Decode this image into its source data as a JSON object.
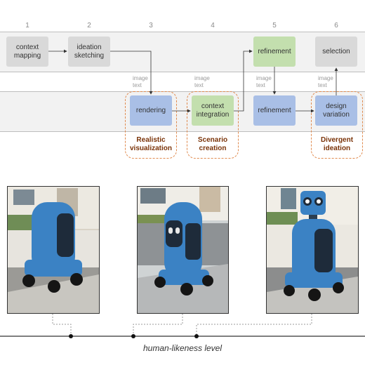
{
  "steps": [
    "1",
    "2",
    "3",
    "4",
    "5",
    "6"
  ],
  "top_row": {
    "context_mapping": "context\nmapping",
    "ideation_sketching": "ideation\nsketching",
    "refinement": "refinement",
    "selection": "selection"
  },
  "bottom_row": {
    "rendering": "rendering",
    "context_integration": "context\nintegration",
    "refinement": "refinement",
    "design_variation": "design\nvariation"
  },
  "io_labels": {
    "l3": "image\ntext",
    "l4": "image\ntext",
    "l5": "image\ntext",
    "l6": "image\ntext"
  },
  "groups": {
    "realistic": "Realistic\nvisualization",
    "scenario": "Scenario\ncreation",
    "divergent": "Divergent\nideation"
  },
  "images": [
    {
      "icon": "robot-image-1",
      "description_hidden": true
    },
    {
      "icon": "robot-image-2",
      "description_hidden": true
    },
    {
      "icon": "robot-image-3",
      "description_hidden": true
    }
  ],
  "axis": {
    "label": "human-likeness level"
  },
  "colors": {
    "gray_box": "#d9d9d9",
    "blue_box": "#a9bfe6",
    "green_box": "#c3dfae",
    "dashed_group": "#e08a4e",
    "group_label": "#7a3308",
    "robot_body": "#3b82c4"
  }
}
